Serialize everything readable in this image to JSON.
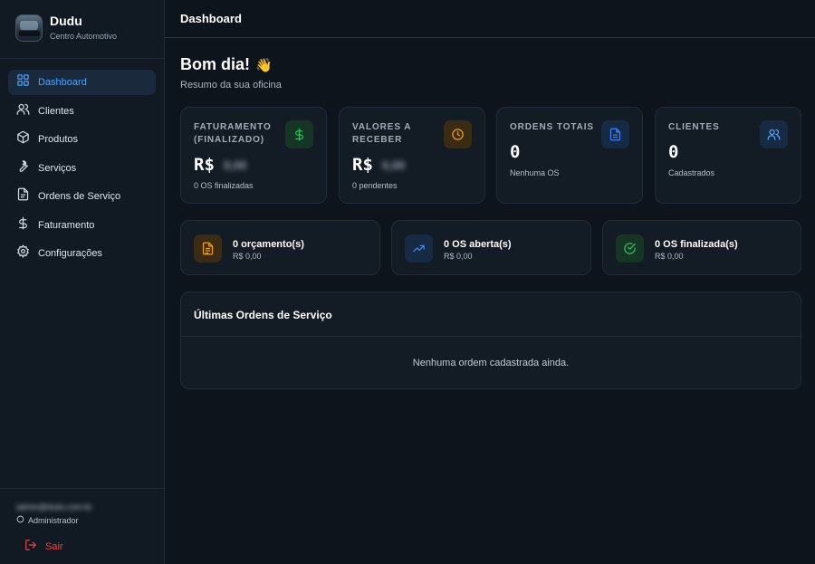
{
  "sidebar": {
    "brand_name": "Dudu",
    "brand_sub": "Centro Automotivo",
    "items": [
      {
        "label": "Dashboard",
        "icon": "grid-icon",
        "active": true
      },
      {
        "label": "Clientes",
        "icon": "users-icon"
      },
      {
        "label": "Produtos",
        "icon": "box-icon"
      },
      {
        "label": "Serviços",
        "icon": "wrench-icon"
      },
      {
        "label": "Ordens de Serviço",
        "icon": "document-icon"
      },
      {
        "label": "Faturamento",
        "icon": "dollar-icon"
      },
      {
        "label": "Configurações",
        "icon": "gear-icon"
      }
    ],
    "user_email": "admin@dudu.com.br",
    "user_role": "Administrador",
    "logout_label": "Sair"
  },
  "header": {
    "title": "Dashboard"
  },
  "greeting": {
    "title": "Bom dia!",
    "emoji": "👋",
    "subtitle": "Resumo da sua oficina"
  },
  "stats": [
    {
      "title": "Faturamento (Finalizado)",
      "prefix": "R$",
      "masked": "0,00",
      "note": "0 OS finalizadas",
      "icon": "dollar-icon",
      "color": "#22c55e"
    },
    {
      "title": "Valores a Receber",
      "prefix": "R$",
      "masked": "0,00",
      "note": "0 pendentes",
      "icon": "clock-icon",
      "color": "#f59e0b"
    },
    {
      "title": "Ordens Totais",
      "value": "0",
      "note": "Nenhuma OS",
      "icon": "file-icon",
      "color": "#3b82f6"
    },
    {
      "title": "Clientes",
      "value": "0",
      "note": "Cadastrados",
      "icon": "users-icon",
      "color": "#60a5fa"
    }
  ],
  "mini": [
    {
      "title": "0 orçamento(s)",
      "sub": "R$ 0,00",
      "icon": "file-text-icon",
      "color": "#f59e0b"
    },
    {
      "title": "0 OS aberta(s)",
      "sub": "R$ 0,00",
      "icon": "trending-up-icon",
      "color": "#3b82f6"
    },
    {
      "title": "0 OS finalizada(s)",
      "sub": "R$ 0,00",
      "icon": "check-circle-icon",
      "color": "#22c55e"
    }
  ],
  "orders": {
    "title": "Últimas Ordens de Serviço",
    "empty": "Nenhuma ordem cadastrada ainda."
  }
}
